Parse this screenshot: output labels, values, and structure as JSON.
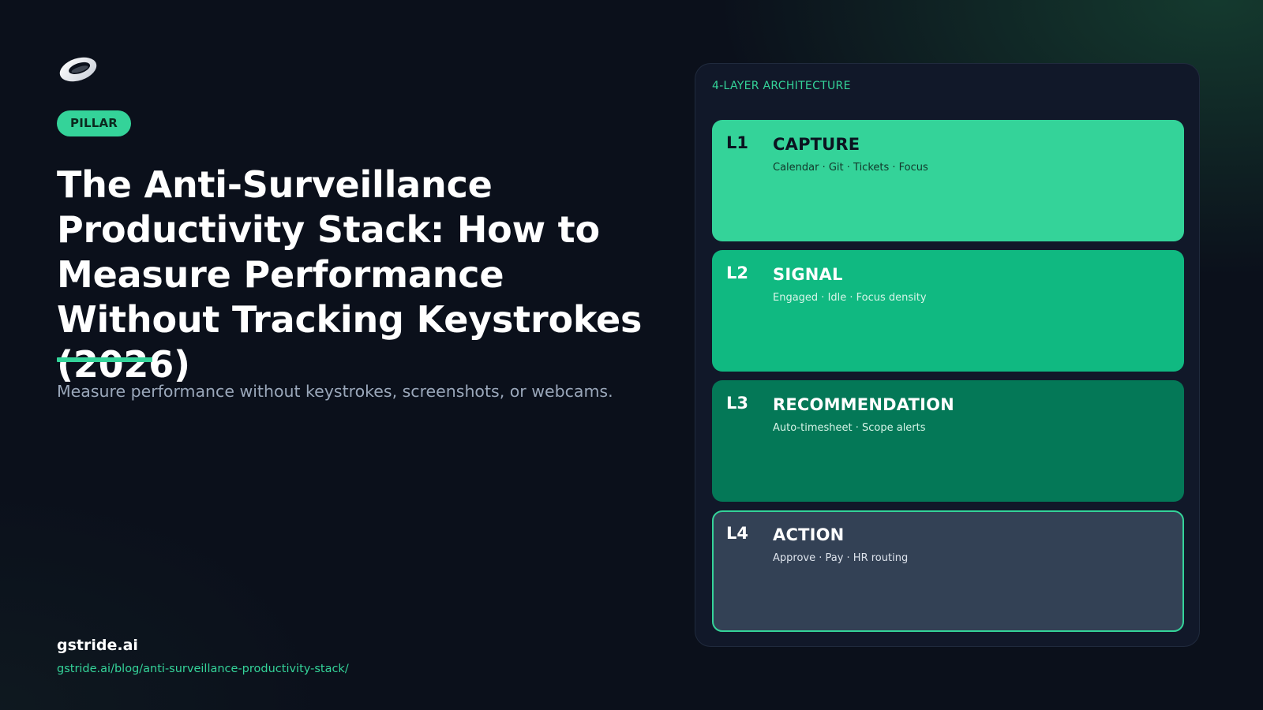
{
  "header": {
    "badge": "PILLAR",
    "title": "The Anti-Surveillance Productivity Stack: How to Measure Performance Without Tracking Keystrokes (2026)",
    "subtitle": "Measure performance without keystrokes, screenshots, or webcams.",
    "logo_icon": "ring-logo-icon"
  },
  "footer": {
    "brand": "gstride.ai",
    "url": "gstride.ai/blog/anti-surveillance-productivity-stack/"
  },
  "architecture": {
    "label": "4-LAYER ARCHITECTURE",
    "layers": [
      {
        "code": "L1",
        "name": "CAPTURE",
        "description": "Calendar · Git · Tickets · Focus",
        "color": "#34d399"
      },
      {
        "code": "L2",
        "name": "SIGNAL",
        "description": "Engaged · Idle · Focus density",
        "color": "#10b981"
      },
      {
        "code": "L3",
        "name": "RECOMMENDATION",
        "description": "Auto-timesheet · Scope alerts",
        "color": "#047857"
      },
      {
        "code": "L4",
        "name": "ACTION",
        "description": "Approve · Pay · HR routing",
        "color": "#334155"
      }
    ]
  },
  "colors": {
    "background": "#0b101b",
    "accent": "#34d399",
    "panel": "#111829",
    "muted_text": "#9aa7ba"
  }
}
